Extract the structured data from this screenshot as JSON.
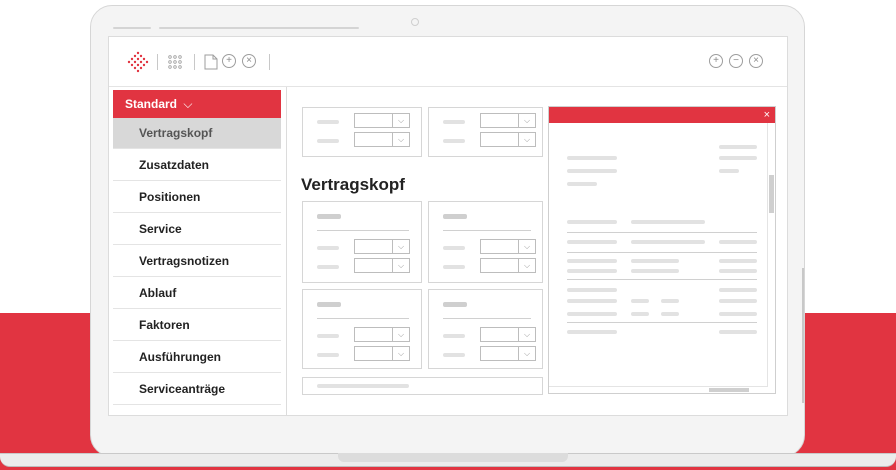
{
  "colors": {
    "accent": "#e13441",
    "text": "#222222",
    "muted": "#e2e2e2"
  },
  "toolbar": {
    "icons_left": [
      "logo-diamond-icon",
      "grid-icon",
      "document-icon",
      "add-icon",
      "close-icon"
    ],
    "icons_right": [
      "zoom-in-icon",
      "zoom-out-icon",
      "close-icon"
    ],
    "glyphs": {
      "add": "+",
      "minus": "−",
      "close": "×"
    }
  },
  "sidebar": {
    "header_label": "Standard",
    "items": [
      {
        "label": "Vertragskopf",
        "active": true
      },
      {
        "label": "Zusatzdaten",
        "active": false
      },
      {
        "label": "Positionen",
        "active": false
      },
      {
        "label": "Service",
        "active": false
      },
      {
        "label": "Vertragsnotizen",
        "active": false
      },
      {
        "label": "Ablauf",
        "active": false
      },
      {
        "label": "Faktoren",
        "active": false
      },
      {
        "label": "Ausführungen",
        "active": false
      },
      {
        "label": "Serviceanträge",
        "active": false
      }
    ]
  },
  "main": {
    "heading": "Vertragskopf"
  },
  "dialog": {
    "close_glyph": "×"
  }
}
